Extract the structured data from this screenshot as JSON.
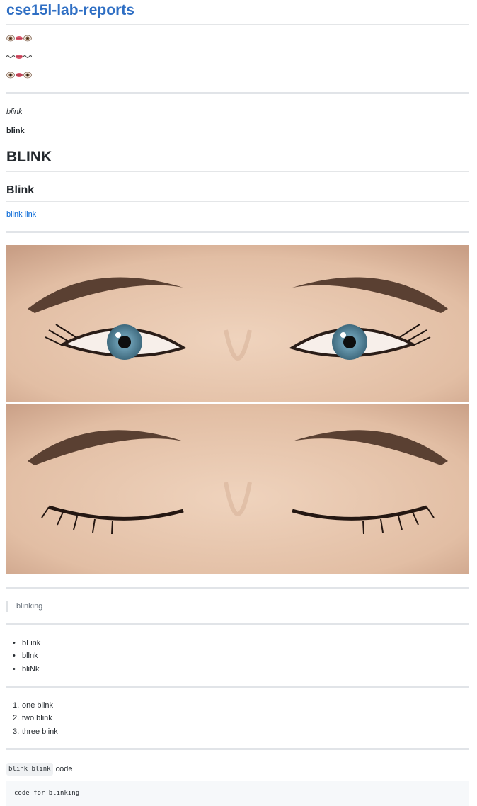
{
  "page": {
    "title": "cse15l-lab-reports",
    "emoji_lines": [
      {
        "icons": [
          "eye-icon",
          "mouth-icon",
          "eye-icon"
        ]
      },
      {
        "icons": [
          "wave-icon",
          "mouth-icon",
          "wave-icon"
        ]
      },
      {
        "icons": [
          "eye-icon",
          "mouth-icon",
          "eye-icon"
        ]
      }
    ],
    "italic_text": "blink",
    "bold_text": "blink",
    "heading1": "BLINK",
    "heading2": "Blink",
    "link_text": "blink link",
    "image_top_icon": "open-eyes-photo",
    "image_bottom_icon": "closed-eyes-photo",
    "blockquote": "blinking",
    "bullets": [
      "bLink",
      "bllnk",
      "bliNk"
    ],
    "ordered": [
      "1.",
      "2.",
      "3."
    ],
    "ordered_items": [
      "one blink",
      "two blink",
      "three blink"
    ],
    "inline_code": "blink blink",
    "inline_suffix": "code",
    "code_block": "code for blinking",
    "colors": {
      "title": "#2f6fc4",
      "link": "#0366d6",
      "text": "#24292e",
      "rule": "#e1e4e8",
      "code_bg": "#f6f8fa",
      "skin": "#e9c8ae",
      "iris": "#5b8fa8"
    }
  }
}
